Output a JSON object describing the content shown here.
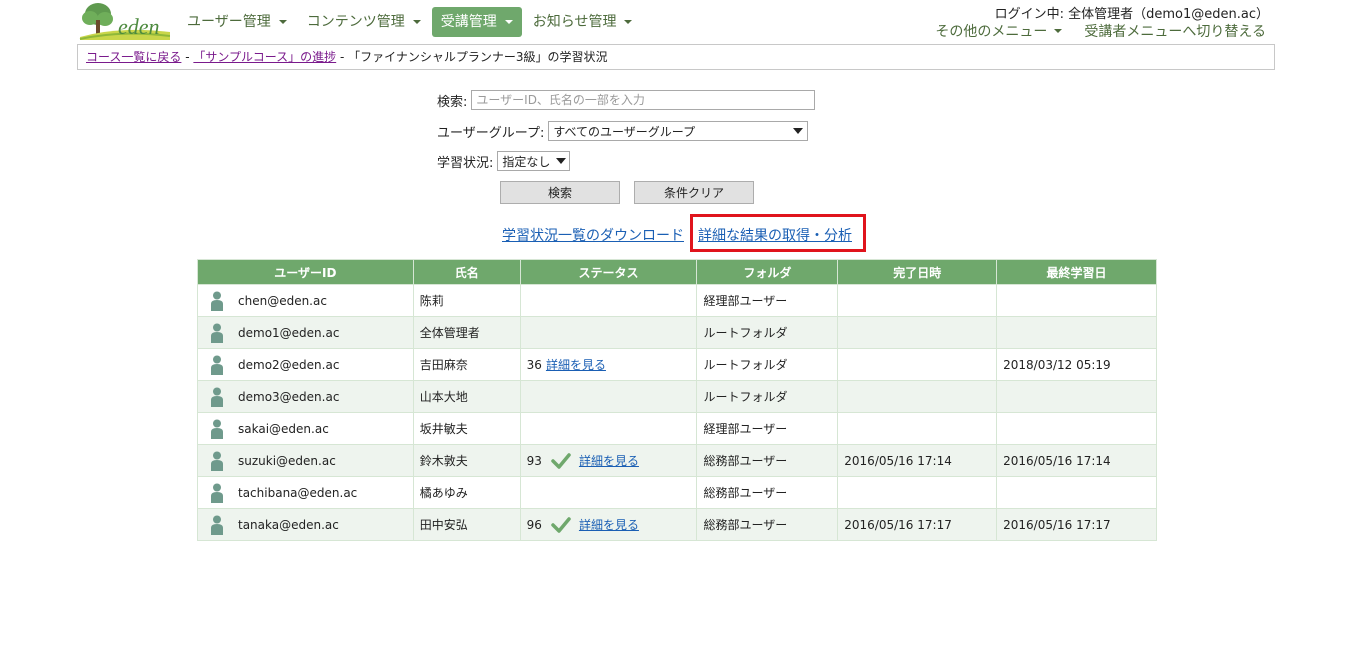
{
  "header": {
    "logo_text": "eden",
    "nav": [
      {
        "label": "ユーザー管理",
        "active": false
      },
      {
        "label": "コンテンツ管理",
        "active": false
      },
      {
        "label": "受講管理",
        "active": true
      },
      {
        "label": "お知らせ管理",
        "active": false
      }
    ],
    "login_status": "ログイン中: 全体管理者（demo1@eden.ac）",
    "other_menu": "その他のメニュー",
    "switch_menu": "受講者メニューへ切り替える"
  },
  "breadcrumb": {
    "back_to_courses": "コース一覧に戻る",
    "sep1": " - ",
    "course_progress": "「サンプルコース」の進捗",
    "sep2": " - ",
    "current": "「ファイナンシャルプランナー3級」の学習状況"
  },
  "search": {
    "label": "検索:",
    "placeholder": "ユーザーID、氏名の一部を入力",
    "value": ""
  },
  "user_group": {
    "label": "ユーザーグループ:",
    "selected": "すべてのユーザーグループ"
  },
  "study_status": {
    "label": "学習状況:",
    "selected": "指定なし"
  },
  "buttons": {
    "search": "検索",
    "clear": "条件クリア"
  },
  "links": {
    "download": "学習状況一覧のダウンロード",
    "analysis": "詳細な結果の取得・分析"
  },
  "table": {
    "headers": [
      "ユーザーID",
      "氏名",
      "ステータス",
      "フォルダ",
      "完了日時",
      "最終学習日"
    ],
    "rows": [
      {
        "user_id": "chen@eden.ac",
        "name": "陈莉",
        "score": "",
        "detail": "",
        "completed": false,
        "folder": "経理部ユーザー",
        "completed_at": "",
        "last_study": ""
      },
      {
        "user_id": "demo1@eden.ac",
        "name": "全体管理者",
        "score": "",
        "detail": "",
        "completed": false,
        "folder": "ルートフォルダ",
        "completed_at": "",
        "last_study": ""
      },
      {
        "user_id": "demo2@eden.ac",
        "name": "吉田麻奈",
        "score": "36",
        "detail": "詳細を見る",
        "completed": false,
        "folder": "ルートフォルダ",
        "completed_at": "",
        "last_study": "2018/03/12 05:19"
      },
      {
        "user_id": "demo3@eden.ac",
        "name": "山本大地",
        "score": "",
        "detail": "",
        "completed": false,
        "folder": "ルートフォルダ",
        "completed_at": "",
        "last_study": ""
      },
      {
        "user_id": "sakai@eden.ac",
        "name": "坂井敏夫",
        "score": "",
        "detail": "",
        "completed": false,
        "folder": "経理部ユーザー",
        "completed_at": "",
        "last_study": ""
      },
      {
        "user_id": "suzuki@eden.ac",
        "name": "鈴木敦夫",
        "score": "93",
        "detail": "詳細を見る",
        "completed": true,
        "folder": "総務部ユーザー",
        "completed_at": "2016/05/16 17:14",
        "last_study": "2016/05/16 17:14"
      },
      {
        "user_id": "tachibana@eden.ac",
        "name": "橘あゆみ",
        "score": "",
        "detail": "",
        "completed": false,
        "folder": "総務部ユーザー",
        "completed_at": "",
        "last_study": ""
      },
      {
        "user_id": "tanaka@eden.ac",
        "name": "田中安弘",
        "score": "96",
        "detail": "詳細を見る",
        "completed": true,
        "folder": "総務部ユーザー",
        "completed_at": "2016/05/16 17:17",
        "last_study": "2016/05/16 17:17"
      }
    ]
  },
  "colors": {
    "brand_green": "#6fa86c",
    "nav_text": "#4d6b3c",
    "link_blue": "#1a5fb4",
    "visited_purple": "#7a1a8c",
    "highlight_red": "#e0141c",
    "alt_row": "#eef4ee"
  },
  "icons": {
    "logo": "tree-logo-icon",
    "user": "person-icon",
    "completed": "checkmark-icon",
    "dropdown": "caret-down-icon"
  }
}
